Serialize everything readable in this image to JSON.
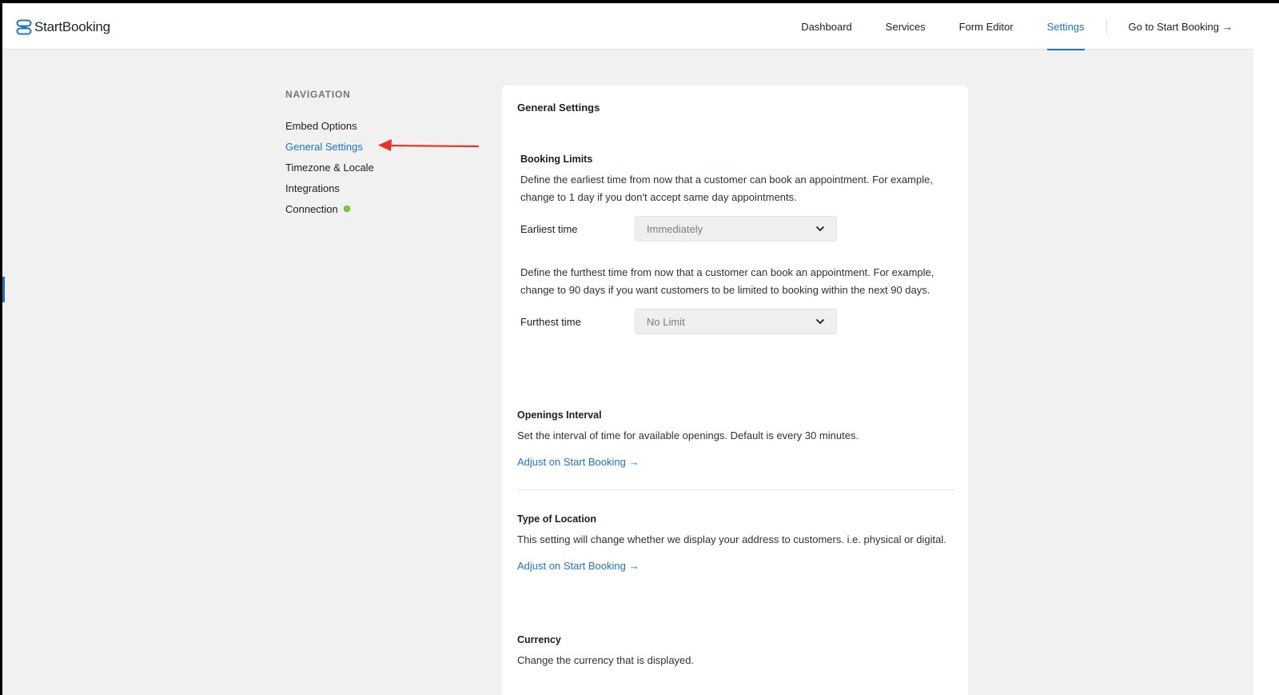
{
  "brand": {
    "name": "StartBooking"
  },
  "topnav": {
    "items": [
      {
        "label": "Dashboard"
      },
      {
        "label": "Services"
      },
      {
        "label": "Form Editor"
      },
      {
        "label": "Settings"
      }
    ],
    "go_label": "Go to Start Booking",
    "go_arrow": "→",
    "active": "Settings"
  },
  "sidenav": {
    "heading": "NAVIGATION",
    "items": [
      {
        "label": "Embed Options"
      },
      {
        "label": "General Settings"
      },
      {
        "label": "Timezone & Locale"
      },
      {
        "label": "Integrations"
      },
      {
        "label": "Connection"
      }
    ],
    "active": "General Settings",
    "connection_status_color": "#7ad03a"
  },
  "card": {
    "title": "General Settings",
    "booking_limits": {
      "heading": "Booking Limits",
      "earliest_desc": "Define the earliest time from now that a customer can book an appointment. For example, change to 1 day if you don't accept same day appointments.",
      "earliest_label": "Earliest time",
      "earliest_value": "Immediately",
      "furthest_desc": "Define the furthest time from now that a customer can book an appointment. For example, change to 90 days if you want customers to be limited to booking within the next 90 days.",
      "furthest_label": "Furthest time",
      "furthest_value": "No Limit"
    },
    "openings_interval": {
      "heading": "Openings Interval",
      "desc": "Set the interval of time for available openings. Default is every 30 minutes.",
      "link": "Adjust on Start Booking →"
    },
    "type_of_location": {
      "heading": "Type of Location",
      "desc": "This setting will change whether we display your address to customers. i.e. physical or digital.",
      "link": "Adjust on Start Booking →"
    },
    "currency": {
      "heading": "Currency",
      "desc": "Change the currency that is displayed."
    }
  },
  "colors": {
    "accent": "#1c75c8",
    "annotation_arrow": "#e8322a",
    "page_bg": "#f1f1f1"
  }
}
